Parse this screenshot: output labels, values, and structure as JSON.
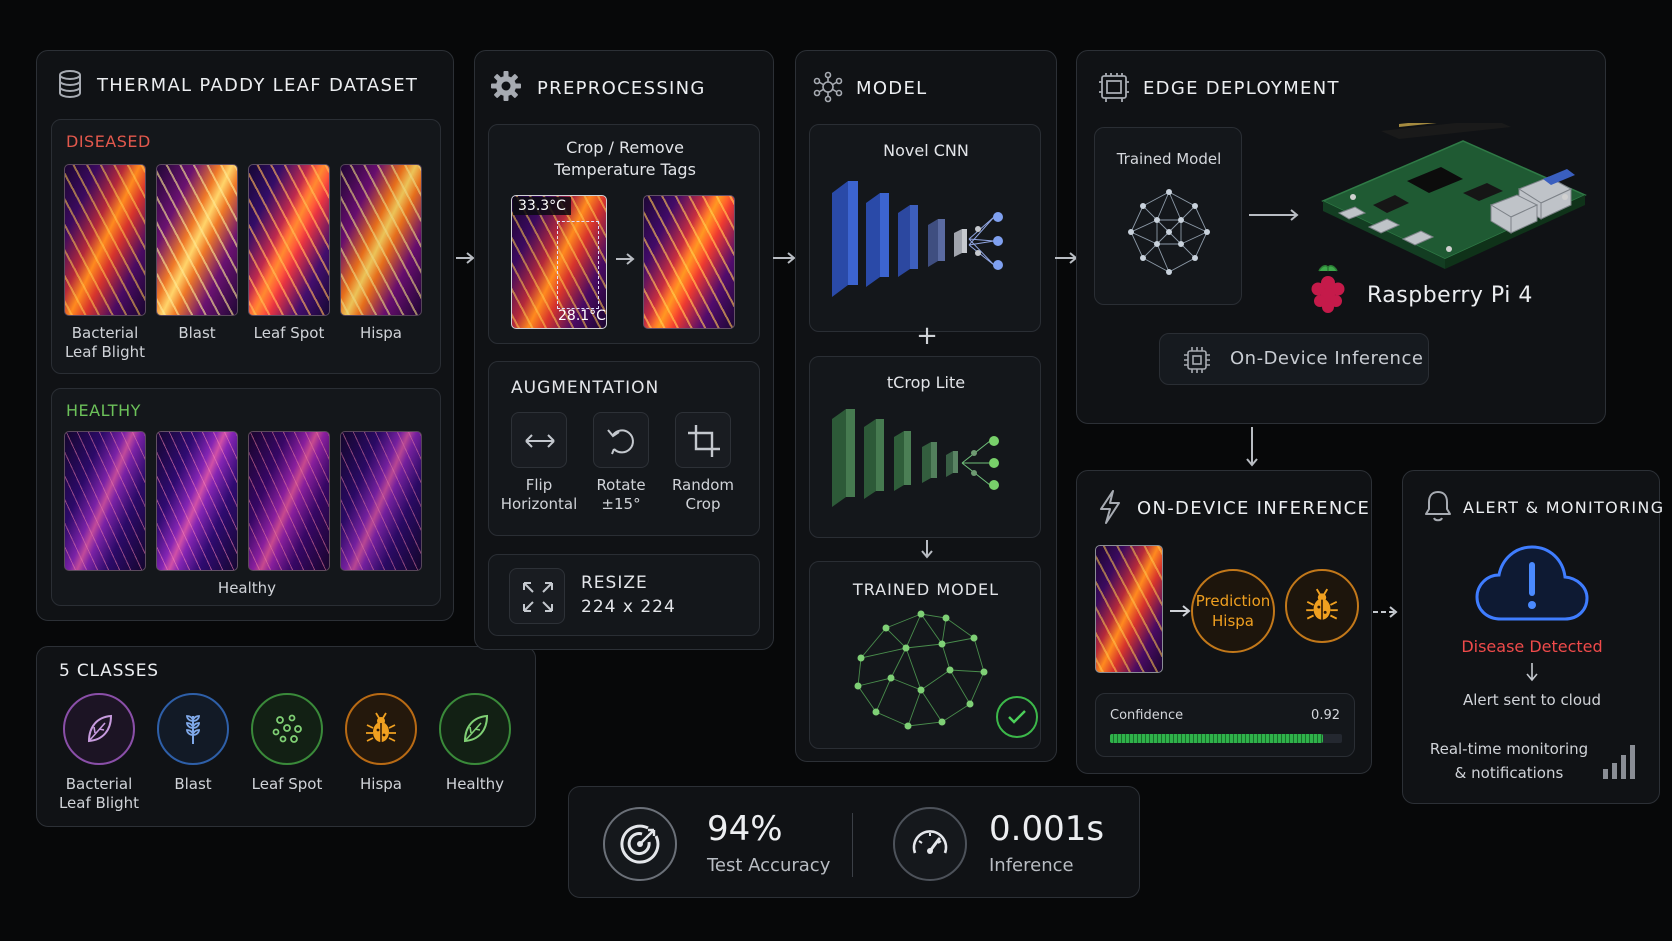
{
  "dataset": {
    "title": "THERMAL PADDY LEAF DATASET",
    "diseased_label": "DISEASED",
    "diseased": [
      "Bacterial\nLeaf Blight",
      "Blast",
      "Leaf Spot",
      "Hispa"
    ],
    "healthy_label": "HEALTHY",
    "healthy_caption": "Healthy"
  },
  "classes": {
    "title": "5 CLASSES",
    "items": [
      "Bacterial\nLeaf Blight",
      "Blast",
      "Leaf Spot",
      "Hispa",
      "Healthy"
    ]
  },
  "preprocessing": {
    "title": "PREPROCESSING",
    "crop_title": "Crop / Remove\nTemperature Tags",
    "temp_high": "33.3°C",
    "temp_low": "28.1°C",
    "augmentation_title": "AUGMENTATION",
    "aug": [
      "Flip\nHorizontal",
      "Rotate\n±15°",
      "Random\nCrop"
    ],
    "resize_title": "RESIZE",
    "resize_value": "224 x 224"
  },
  "model": {
    "title": "MODEL",
    "cnn_title": "Novel CNN",
    "plus": "+",
    "tcrop_title": "tCrop Lite",
    "trained_title": "TRAINED MODEL"
  },
  "edge": {
    "title": "EDGE DEPLOYMENT",
    "trained_model": "Trained Model",
    "device": "Raspberry Pi 4",
    "inference_btn": "On-Device Inference"
  },
  "inference": {
    "title": "ON-DEVICE INFERENCE",
    "prediction_label": "Prediction",
    "prediction_value": "Hispa",
    "confidence_label": "Confidence",
    "confidence_value": "0.92",
    "confidence": 0.92
  },
  "alert": {
    "title": "ALERT & MONITORING",
    "detected": "Disease Detected",
    "sent": "Alert sent to cloud",
    "monitoring": "Real-time monitoring\n& notifications"
  },
  "metrics": {
    "accuracy_value": "94%",
    "accuracy_label": "Test Accuracy",
    "inference_value": "0.001s",
    "inference_label": "Inference"
  },
  "colors": {
    "diseased": "#e2584c",
    "healthy": "#6cc25a",
    "accent_orange": "#f0a020",
    "alert_red": "#ef4a4a",
    "cloud_blue": "#3f7dff",
    "progress_green": "#2fb24a"
  }
}
